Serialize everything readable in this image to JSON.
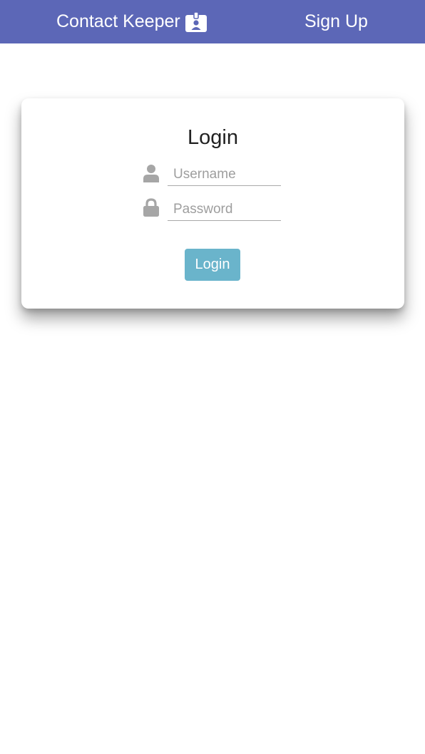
{
  "navbar": {
    "brand_label": "Contact Keeper",
    "brand_icon": "id-badge-icon",
    "signup_label": "Sign Up",
    "background_color": "#5c67b7"
  },
  "login_card": {
    "title": "Login",
    "username": {
      "icon": "user-icon",
      "placeholder": "Username",
      "value": ""
    },
    "password": {
      "icon": "lock-icon",
      "placeholder": "Password",
      "value": ""
    },
    "submit_label": "Login",
    "submit_color": "#6ab4cb"
  }
}
